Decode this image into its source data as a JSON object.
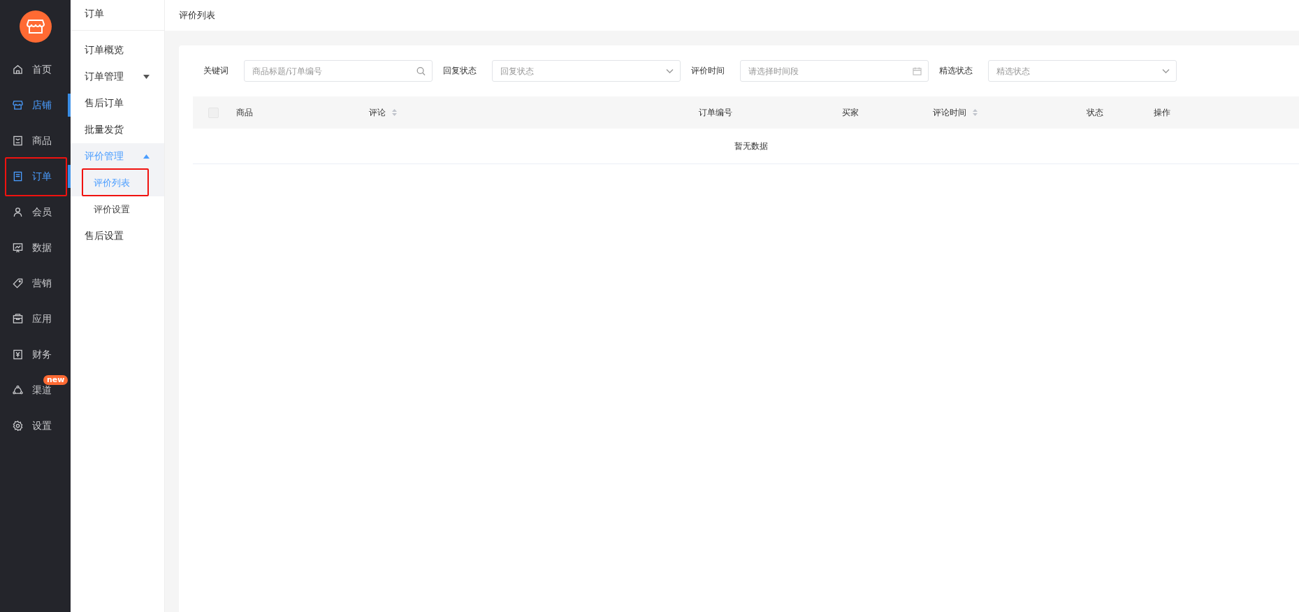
{
  "sidebar": {
    "items": [
      {
        "label": "首页",
        "selected": false,
        "highlighted": false
      },
      {
        "label": "店铺",
        "selected": true,
        "highlighted": false
      },
      {
        "label": "商品",
        "selected": false,
        "highlighted": false
      },
      {
        "label": "订单",
        "selected": true,
        "highlighted": true
      },
      {
        "label": "会员",
        "selected": false,
        "highlighted": false
      },
      {
        "label": "数据",
        "selected": false,
        "highlighted": false
      },
      {
        "label": "营销",
        "selected": false,
        "highlighted": false
      },
      {
        "label": "应用",
        "selected": false,
        "highlighted": false
      },
      {
        "label": "财务",
        "selected": false,
        "highlighted": false
      },
      {
        "label": "渠道",
        "selected": false,
        "highlighted": false,
        "badge": "new"
      },
      {
        "label": "设置",
        "selected": false,
        "highlighted": false
      }
    ]
  },
  "subnav": {
    "title": "订单",
    "items": [
      {
        "label": "订单概览",
        "selected": false
      },
      {
        "label": "订单管理",
        "selected": false,
        "expanded": false
      },
      {
        "label": "售后订单",
        "selected": false
      },
      {
        "label": "批量发货",
        "selected": false
      },
      {
        "label": "评价管理",
        "selected": true,
        "expanded": true,
        "children": [
          {
            "label": "评价列表",
            "selected": true,
            "highlighted": true
          },
          {
            "label": "评价设置",
            "selected": false,
            "highlighted": false
          }
        ]
      },
      {
        "label": "售后设置",
        "selected": false
      }
    ]
  },
  "page_title": "评价列表",
  "filters": [
    {
      "label": "关键词",
      "kind": "search",
      "placeholder": "商品标题/订单编号"
    },
    {
      "label": "回复状态",
      "kind": "select",
      "placeholder": "回复状态"
    },
    {
      "label": "评价时间",
      "kind": "date",
      "placeholder": "请选择时间段"
    },
    {
      "label": "精选状态",
      "kind": "select",
      "placeholder": "精选状态"
    }
  ],
  "table": {
    "columns": [
      {
        "label": "商品",
        "sortable": false
      },
      {
        "label": "评论",
        "sortable": true
      },
      {
        "label": "订单编号",
        "sortable": false
      },
      {
        "label": "买家",
        "sortable": false
      },
      {
        "label": "评论时间",
        "sortable": true
      },
      {
        "label": "状态",
        "sortable": false
      },
      {
        "label": "操作",
        "sortable": false
      }
    ],
    "select_all_checked": false,
    "empty_text": "暂无数据"
  }
}
